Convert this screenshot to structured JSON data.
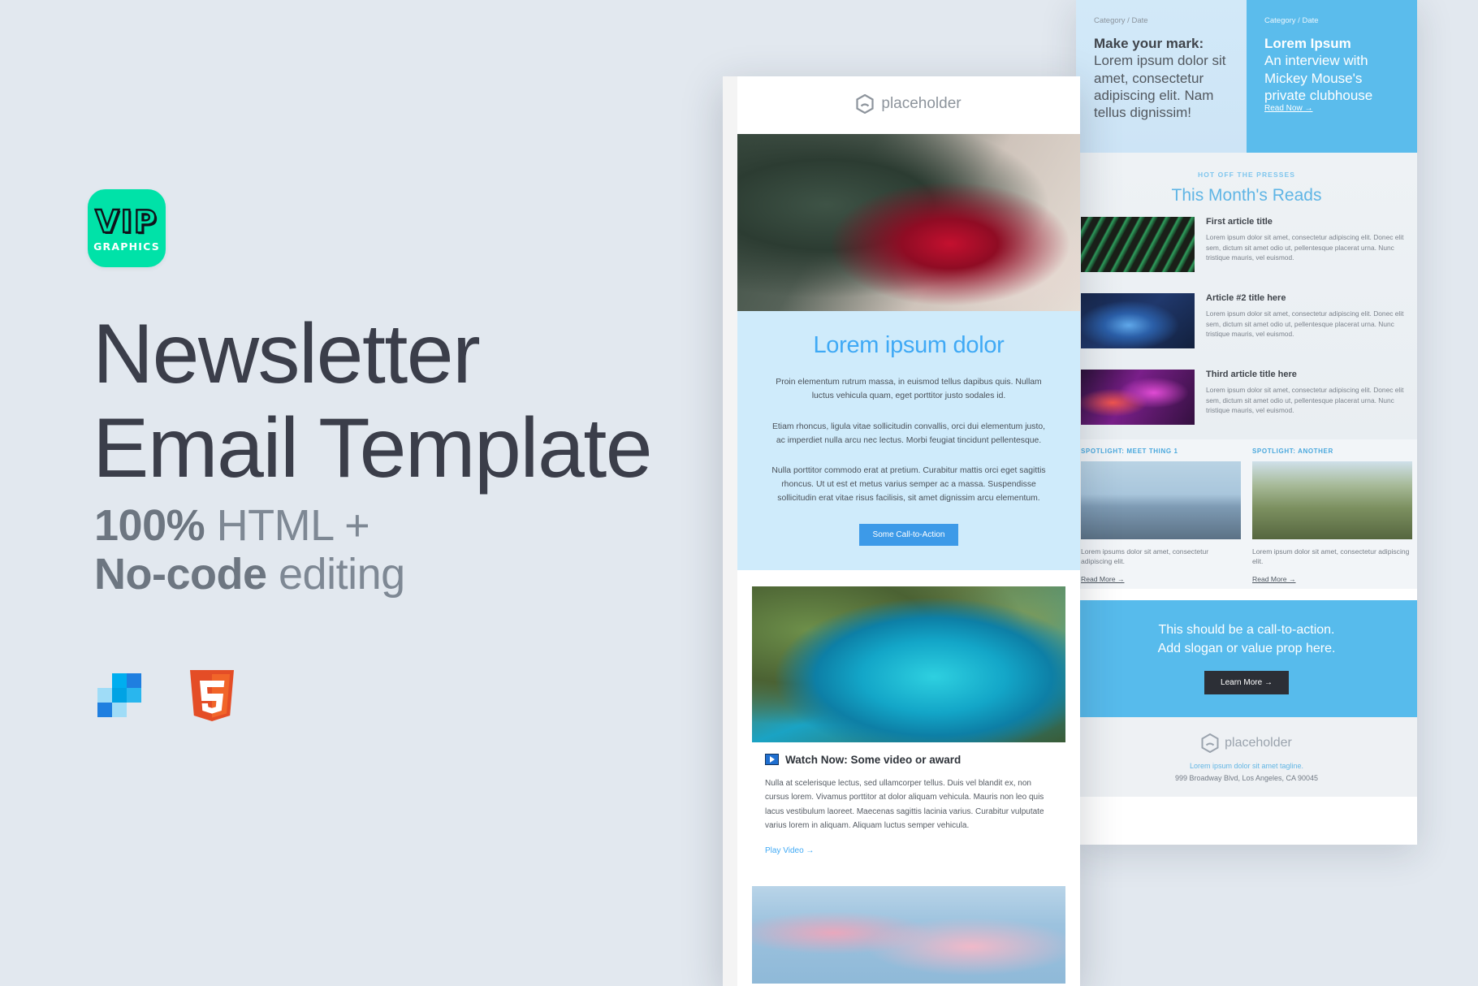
{
  "brand": {
    "logo_line1": "VIP",
    "logo_line2": "GRAPHICS",
    "logo_color": "#00e2a8"
  },
  "promo": {
    "title_line1": "Newsletter",
    "title_line2": "Email Template",
    "sub_strong_1": "100%",
    "sub_rest_1": " HTML +",
    "sub_strong_2": "No-code",
    "sub_rest_2": " editing",
    "icons": [
      "stripo-mosaic-icon",
      "html5-icon"
    ],
    "title_color": "#3b3e4a",
    "sub_color": "#7e8894",
    "background_color": "#e2e8ef"
  },
  "front_email": {
    "logo_text": "placeholder",
    "hero_title": "Lorem ipsum dolor",
    "para1": "Proin elementum rutrum massa, in euismod tellus dapibus quis. Nullam luctus vehicula quam, eget porttitor justo sodales id.",
    "para2": "Etiam rhoncus, ligula vitae sollicitudin convallis, orci dui elementum justo, ac imperdiet nulla arcu nec lectus. Morbi feugiat tincidunt pellentesque.",
    "para3": "Nulla porttitor commodo erat at pretium. Curabitur mattis orci eget sagittis rhoncus. Ut ut est et metus varius semper ac a massa. Suspendisse sollicitudin erat vitae risus facilisis, sit amet dignissim arcu elementum.",
    "cta_label": "Some Call-to-Action",
    "video_title": "Watch Now: Some video or award",
    "video_body": "Nulla at scelerisque lectus, sed ullamcorper tellus. Duis vel blandit ex, non cursus lorem. Vivamus porttitor at dolor aliquam vehicula. Mauris non leo quis lacus vestibulum laoreet. Maecenas sagittis lacinia varius. Curabitur vulputate varius lorem in aliquam. Aliquam luctus semper vehicula.",
    "video_link": "Play Video  →"
  },
  "back_email": {
    "hero_left": {
      "category": "Category / Date",
      "title_bold": "Make your mark:",
      "title_rest": "Lorem ipsum dolor sit amet, consectetur adipiscing elit. Nam tellus dignissim!"
    },
    "hero_right": {
      "category": "Category / Date",
      "title_bold": "Lorem Ipsum",
      "title_rest": "An interview with Mickey Mouse's private clubhouse",
      "link": "Read Now →"
    },
    "reads": {
      "eyebrow": "HOT OFF THE PRESSES",
      "title": "This Month's Reads",
      "articles": [
        {
          "title": "First article title",
          "body": "Lorem ipsum dolor sit amet, consectetur adipiscing elit. Donec elit sem, dictum sit amet odio ut, pellentesque placerat urna. Nunc tristique mauris, vel euismod."
        },
        {
          "title": "Article #2 title here",
          "body": "Lorem ipsum dolor sit amet, consectetur adipiscing elit. Donec elit sem, dictum sit amet odio ut, pellentesque placerat urna. Nunc tristique mauris, vel euismod."
        },
        {
          "title": "Third article title here",
          "body": "Lorem ipsum dolor sit amet, consectetur adipiscing elit. Donec elit sem, dictum sit amet odio ut, pellentesque placerat urna. Nunc tristique mauris, vel euismod."
        }
      ]
    },
    "spotlights": [
      {
        "eyebrow": "SPOTLIGHT: MEET THING 1",
        "body": "Lorem ipsums dolor sit amet, consectetur adipiscing elit.",
        "link": "Read More →"
      },
      {
        "eyebrow": "SPOTLIGHT: ANOTHER",
        "body": "Lorem ipsum dolor sit amet, consectetur adipiscing elit.",
        "link": "Read More →"
      }
    ],
    "cta": {
      "line1": "This should be a call-to-action.",
      "line2": "Add slogan or value prop here.",
      "button": "Learn More →"
    },
    "footer": {
      "logo_text": "placeholder",
      "tagline": "Lorem ipsum dolor sit amet tagline.",
      "address": "999 Broadway Blvd, Los Angeles, CA 90045"
    }
  }
}
